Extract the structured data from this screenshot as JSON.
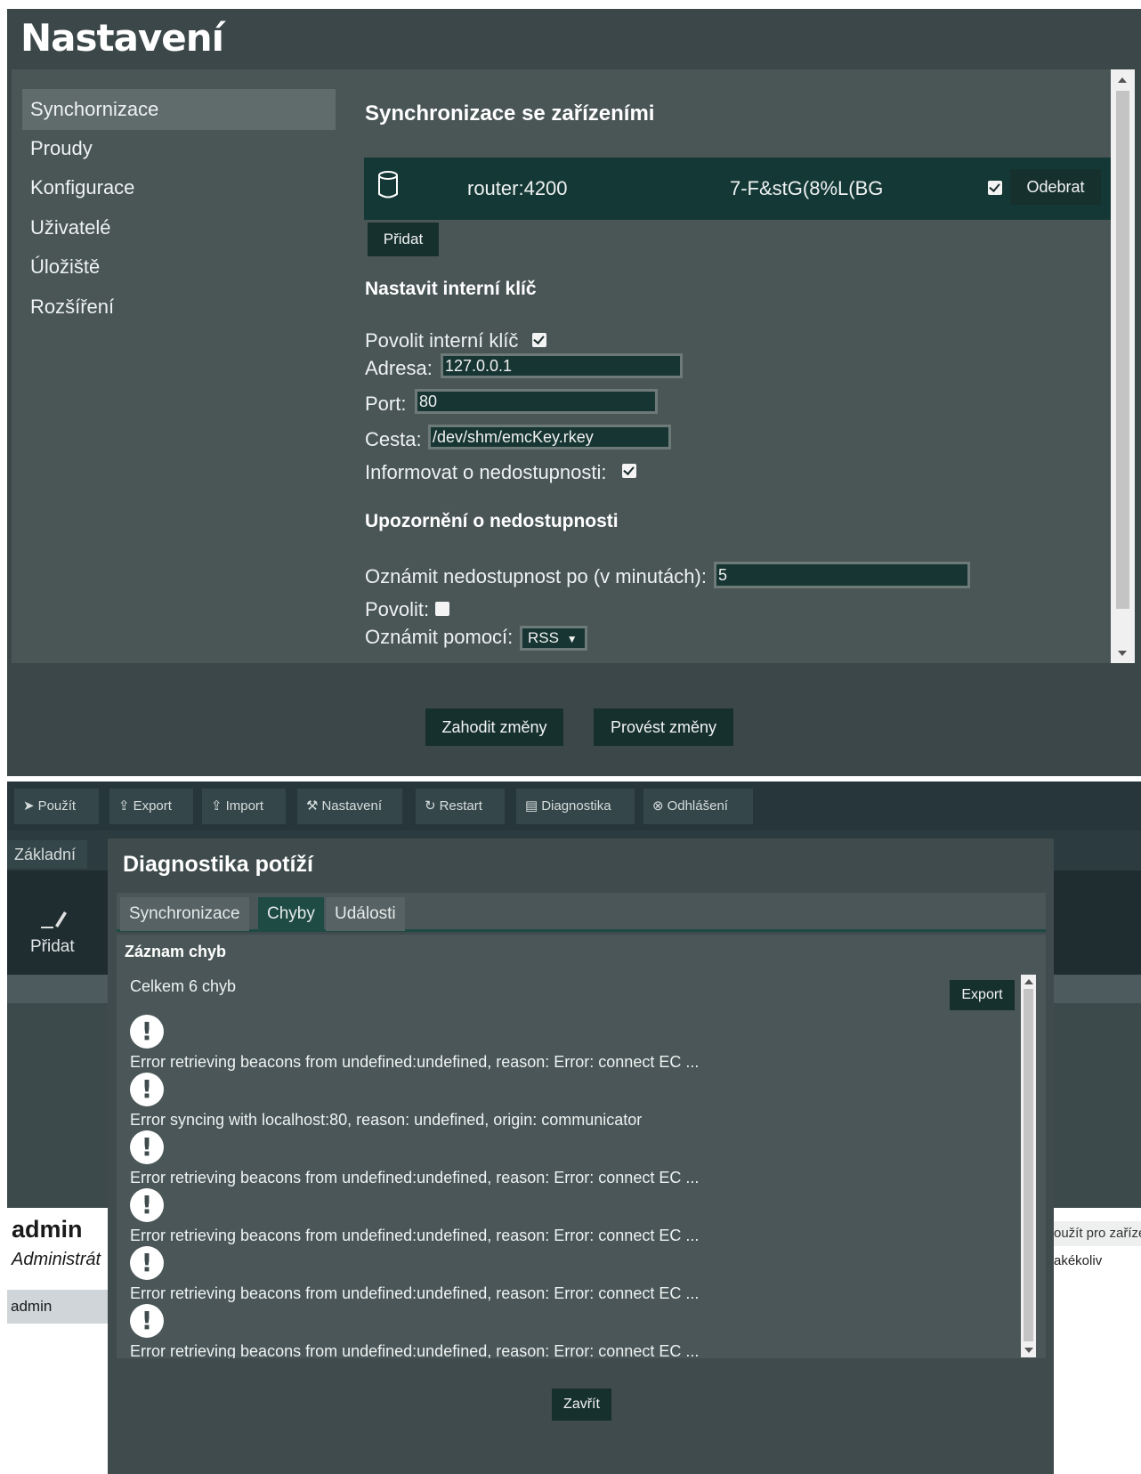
{
  "settings": {
    "title": "Nastavení",
    "nav": [
      {
        "label": "Synchornizace"
      },
      {
        "label": "Proudy"
      },
      {
        "label": "Konfigurace"
      },
      {
        "label": "Uživatelé"
      },
      {
        "label": "Úložiště"
      },
      {
        "label": "Rozšíření"
      }
    ],
    "sync_heading": "Synchronizace se zařízeními",
    "device": {
      "address": "router:4200",
      "key": "7-F&stG(8%L(BG",
      "enabled": true,
      "remove_label": "Odebrat"
    },
    "add_label": "Přidat",
    "internal_key_heading": "Nastavit interní klíč",
    "enable_internal_key_label": "Povolit interní klíč",
    "address_label": "Adresa:",
    "address_value": "127.0.0.1",
    "port_label": "Port:",
    "port_value": "80",
    "path_label": "Cesta:",
    "path_value": "/dev/shm/emcKey.rkey",
    "inform_label": "Informovat o nedostupnosti:",
    "unavailability_heading": "Upozornění o nedostupnosti",
    "notify_after_label": "Oznámit nedostupnost po (v minutách):",
    "notify_after_value": "5",
    "allow_label": "Povolit:",
    "notify_via_label": "Oznámit pomocí:",
    "notify_via_value": "RSS",
    "discard_label": "Zahodit změny",
    "apply_label": "Provést změny"
  },
  "app": {
    "toolbar": [
      {
        "icon": "➤",
        "label": "Použít"
      },
      {
        "icon": "⇪",
        "label": "Export"
      },
      {
        "icon": "⇪",
        "label": "Import"
      },
      {
        "icon": "⚒",
        "label": "Nastavení"
      },
      {
        "icon": "↻",
        "label": "Restart"
      },
      {
        "icon": "▤",
        "label": "Diagnostika"
      },
      {
        "icon": "⊗",
        "label": "Odhlášení"
      }
    ],
    "tab_basic": "Základní",
    "add_label": "Přidat",
    "user_name": "admin",
    "user_role": "Administrát",
    "user_row": "admin",
    "right_col_header": "oužít pro zaříze",
    "right_col_value": "akékoliv"
  },
  "diagnostics": {
    "title": "Diagnostika potíží",
    "tabs": [
      {
        "label": "Synchronizace"
      },
      {
        "label": "Chyby"
      },
      {
        "label": "Události"
      }
    ],
    "log_heading": "Záznam chyb",
    "total": "Celkem 6 chyb",
    "export_label": "Export",
    "errors": [
      {
        "text": "Error retrieving beacons from undefined:undefined, reason: Error: connect EC ..."
      },
      {
        "text": "Error syncing with localhost:80, reason: undefined, origin: communicator"
      },
      {
        "text": "Error retrieving beacons from undefined:undefined, reason: Error: connect EC ..."
      },
      {
        "text": "Error retrieving beacons from undefined:undefined, reason: Error: connect EC ..."
      },
      {
        "text": "Error retrieving beacons from undefined:undefined, reason: Error: connect EC ..."
      },
      {
        "text": "Error retrieving beacons from undefined:undefined, reason: Error: connect EC ..."
      }
    ],
    "close_label": "Zavřít"
  }
}
